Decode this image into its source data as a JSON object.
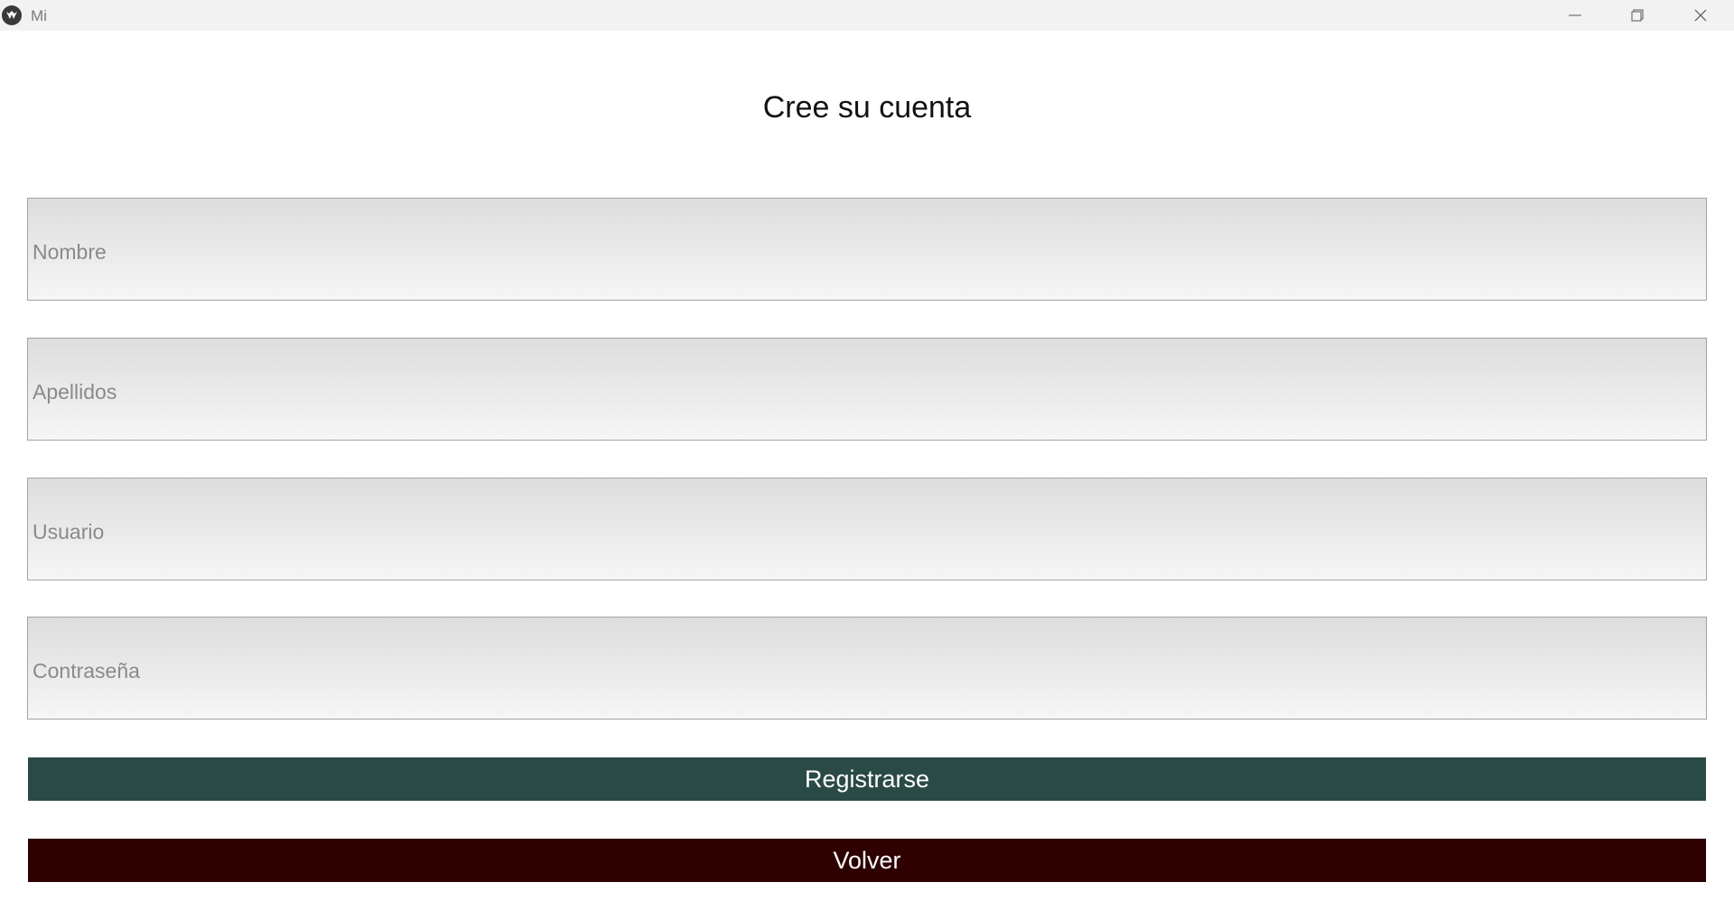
{
  "window": {
    "title": "Mi"
  },
  "form": {
    "heading": "Cree su cuenta",
    "fields": [
      {
        "placeholder": "Nombre",
        "value": ""
      },
      {
        "placeholder": "Apellidos",
        "value": ""
      },
      {
        "placeholder": "Usuario",
        "value": ""
      },
      {
        "placeholder": "Contraseña",
        "value": ""
      }
    ],
    "register_label": "Registrarse",
    "back_label": "Volver"
  },
  "colors": {
    "register_bg": "#2a4a45",
    "back_bg": "#2e0000"
  }
}
